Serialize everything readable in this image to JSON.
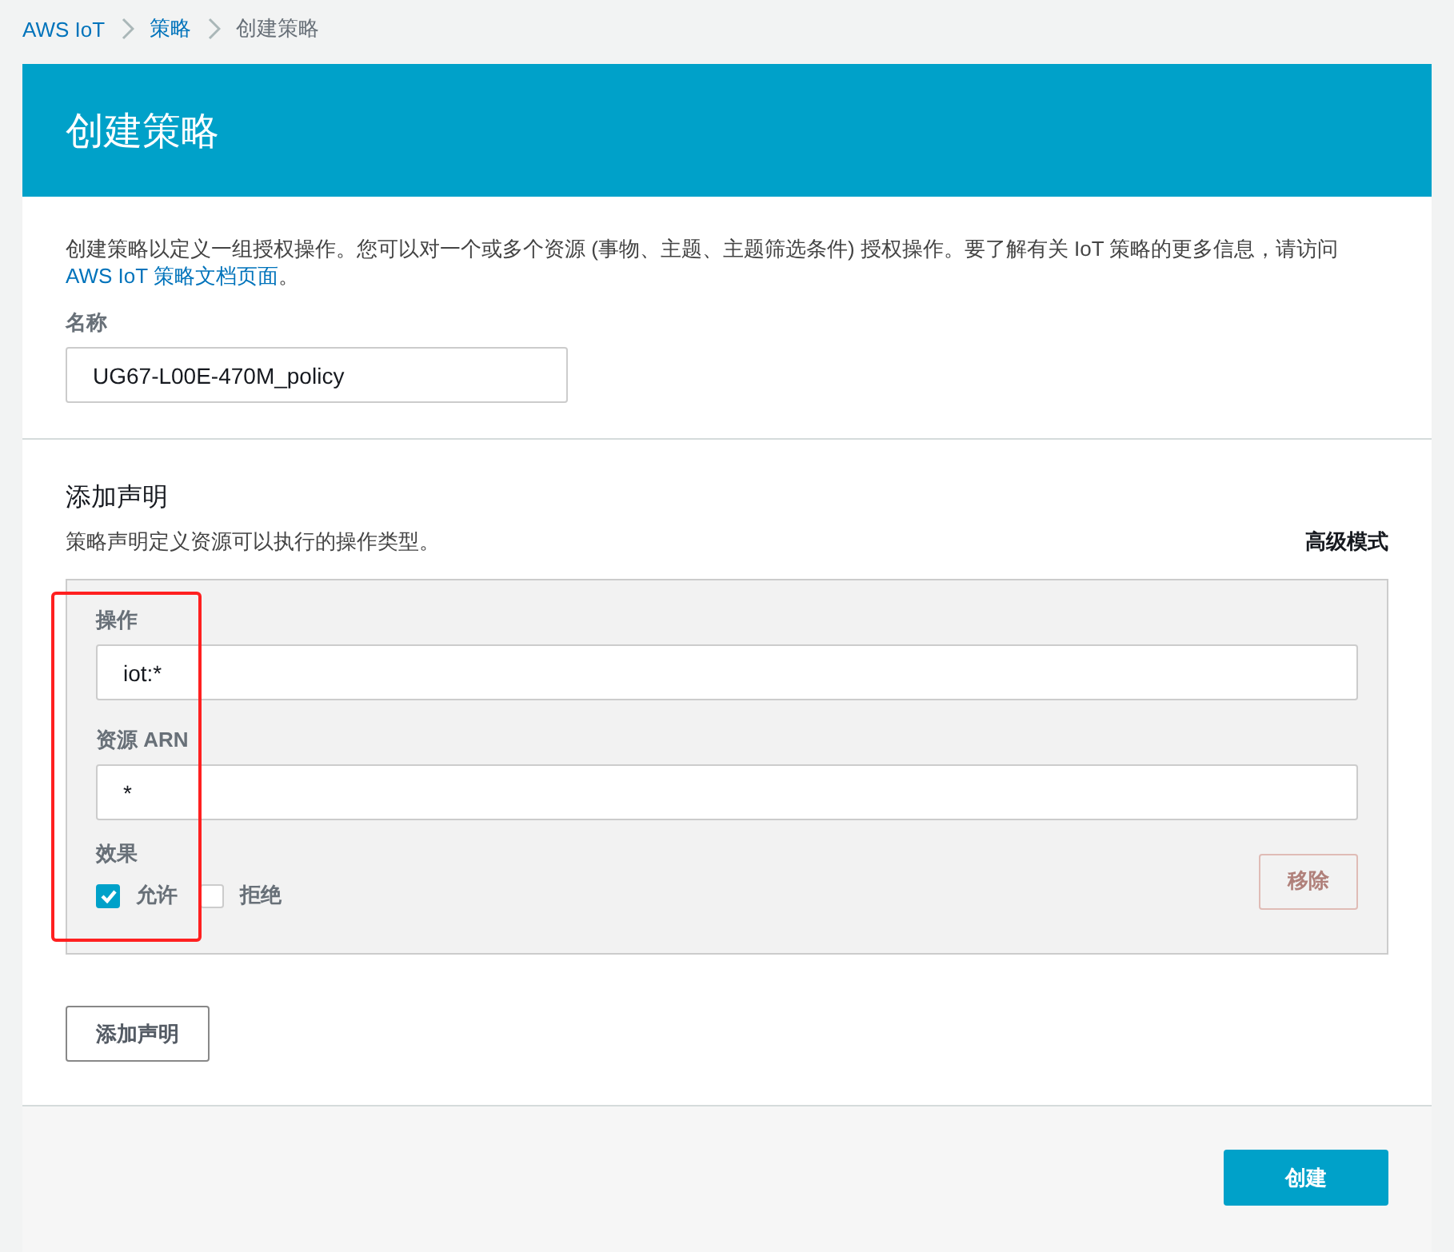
{
  "breadcrumb": [
    {
      "label": "AWS IoT",
      "kind": "link"
    },
    {
      "label": "策略",
      "kind": "link"
    },
    {
      "label": "创建策略",
      "kind": "current"
    }
  ],
  "header": {
    "title": "创建策略"
  },
  "intro": {
    "text": "创建策略以定义一组授权操作。您可以对一个或多个资源 (事物、主题、主题筛选条件) 授权操作。要了解有关 IoT 策略的更多信息，请访问 ",
    "link": "AWS IoT 策略文档页面",
    "after": "。"
  },
  "name_field": {
    "label": "名称",
    "value": "UG67-L00E-470M_policy"
  },
  "statements_section": {
    "title": "添加声明",
    "subtitle": "策略声明定义资源可以执行的操作类型。",
    "mode_link": "高级模式"
  },
  "statements": [
    {
      "action_label": "操作",
      "action": "iot:*",
      "resource_label": "资源 ARN",
      "resource": "*",
      "effect_label": "效果",
      "effects": [
        {
          "label": "允许",
          "checked": true
        },
        {
          "label": "拒绝",
          "checked": false
        }
      ],
      "remove_button": {
        "label": "移除",
        "disabled": true
      }
    }
  ],
  "add_button": "添加声明",
  "create_button": "创建"
}
